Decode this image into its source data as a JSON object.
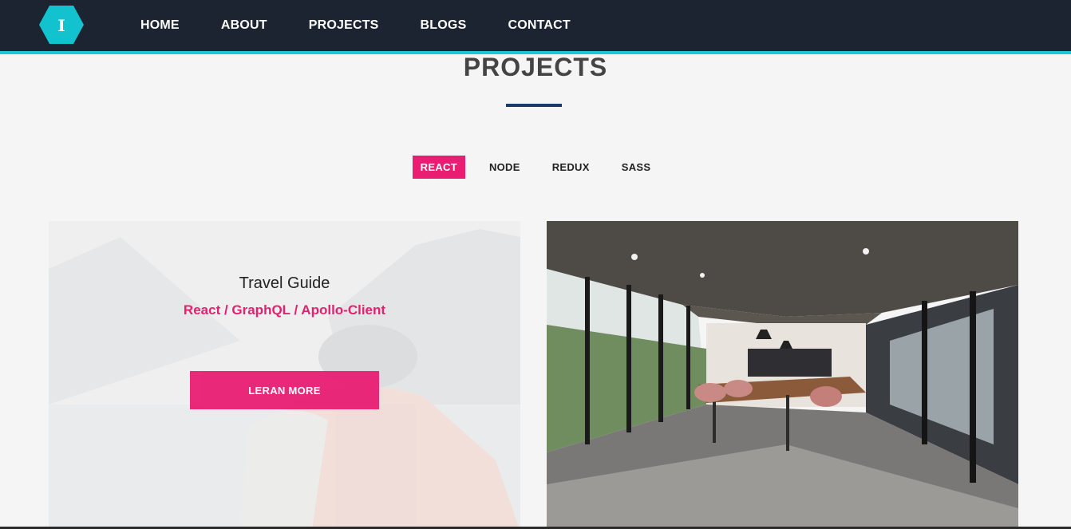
{
  "nav": {
    "logo_letter": "I",
    "links": [
      {
        "label": "HOME"
      },
      {
        "label": "ABOUT"
      },
      {
        "label": "PROJECTS"
      },
      {
        "label": "BLOGS"
      },
      {
        "label": "CONTACT"
      }
    ]
  },
  "section": {
    "title": "PROJECTS"
  },
  "filters": [
    {
      "label": "REACT",
      "active": true
    },
    {
      "label": "NODE",
      "active": false
    },
    {
      "label": "REDUX",
      "active": false
    },
    {
      "label": "SASS",
      "active": false
    }
  ],
  "projects": [
    {
      "title": "Travel Guide",
      "tags": "React / GraphQL / Apollo-Client",
      "button_label": "LERAN MORE",
      "image": "travel-backpacker-mountains"
    },
    {
      "image": "modern-office-conference-room"
    }
  ],
  "colors": {
    "nav_bg": "#1c2331",
    "nav_accent": "#1ac7d4",
    "primary": "#e91e73",
    "title_underline": "#173a6b"
  }
}
